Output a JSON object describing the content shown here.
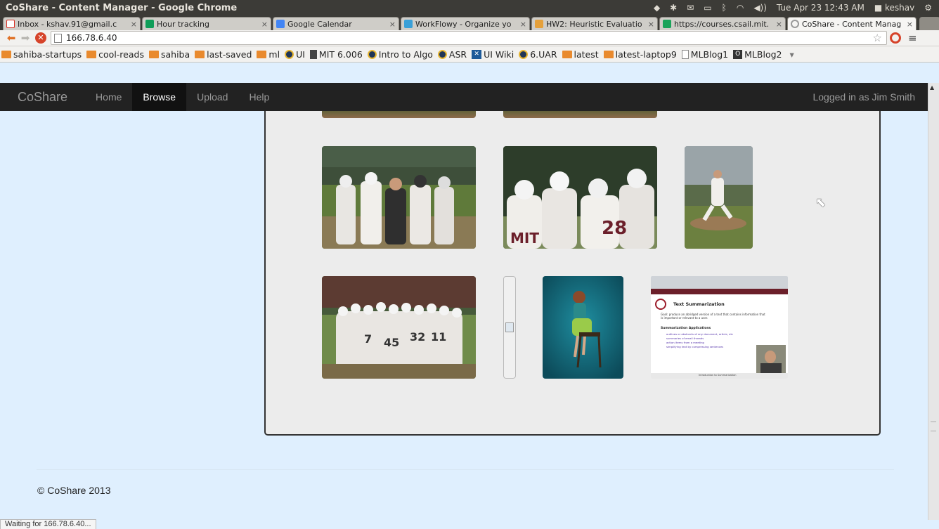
{
  "os": {
    "window_title": "CoShare - Content Manager - Google Chrome",
    "clock": "Tue Apr 23 12:43 AM",
    "user": "keshav"
  },
  "tabs": [
    {
      "label": "Inbox - kshav.91@gmail.c",
      "icon": "gmail-icon",
      "color": "#d93025",
      "close": "×"
    },
    {
      "label": "Hour tracking",
      "icon": "sheets-icon",
      "color": "#0f9d58",
      "close": "×"
    },
    {
      "label": "Google Calendar",
      "icon": "calendar-icon",
      "color": "#4285f4",
      "close": "×"
    },
    {
      "label": "WorkFlowy - Organize yo",
      "icon": "workflowy-icon",
      "color": "#3aa0d8",
      "close": "×"
    },
    {
      "label": "HW2: Heuristic Evaluatio",
      "icon": "hw2-icon",
      "color": "#e5a03a",
      "close": "×"
    },
    {
      "label": "https://courses.csail.mit.",
      "icon": "courses-icon",
      "color": "#1aa35a",
      "close": "×"
    },
    {
      "label": "CoShare - Content Manag",
      "icon": "loading-icon",
      "color": "#999999",
      "close": "×"
    }
  ],
  "toolbar": {
    "url": "166.78.6.40"
  },
  "bookmarks": [
    {
      "label": "sahiba-startups",
      "icon": "folder"
    },
    {
      "label": "cool-reads",
      "icon": "folder"
    },
    {
      "label": "sahiba",
      "icon": "folder"
    },
    {
      "label": "last-saved",
      "icon": "folder"
    },
    {
      "label": "ml",
      "icon": "folder"
    },
    {
      "label": "UI",
      "icon": "circ"
    },
    {
      "label": "MIT 6.006",
      "icon": "mit"
    },
    {
      "label": "Intro to Algo",
      "icon": "circ"
    },
    {
      "label": "ASR",
      "icon": "circ"
    },
    {
      "label": "UI Wiki",
      "icon": "uiw"
    },
    {
      "label": "6.UAR",
      "icon": "circ"
    },
    {
      "label": "latest",
      "icon": "folder"
    },
    {
      "label": "latest-laptop9",
      "icon": "folder"
    },
    {
      "label": "MLBlog1",
      "icon": "doc"
    },
    {
      "label": "MLBlog2",
      "icon": "box"
    }
  ],
  "site": {
    "brand": "CoShare",
    "nav": [
      "Home",
      "Browse",
      "Upload",
      "Help"
    ],
    "active": "Browse",
    "login": "Logged in as Jim Smith",
    "footer": "© CoShare 2013"
  },
  "slide": {
    "title": "Text Summarization",
    "bullet1": "Goal: produce an abridged version of a text that contains information that is important or relevant to a user.",
    "heading2": "Summarization Applications",
    "items": [
      "outlines or abstracts of any document, article, etc",
      "summaries of email threads",
      "action items from a meeting",
      "simplifying text by compressing sentences"
    ],
    "footer": "Introduction to Summarization"
  },
  "status": "Waiting for 166.78.6.40..."
}
